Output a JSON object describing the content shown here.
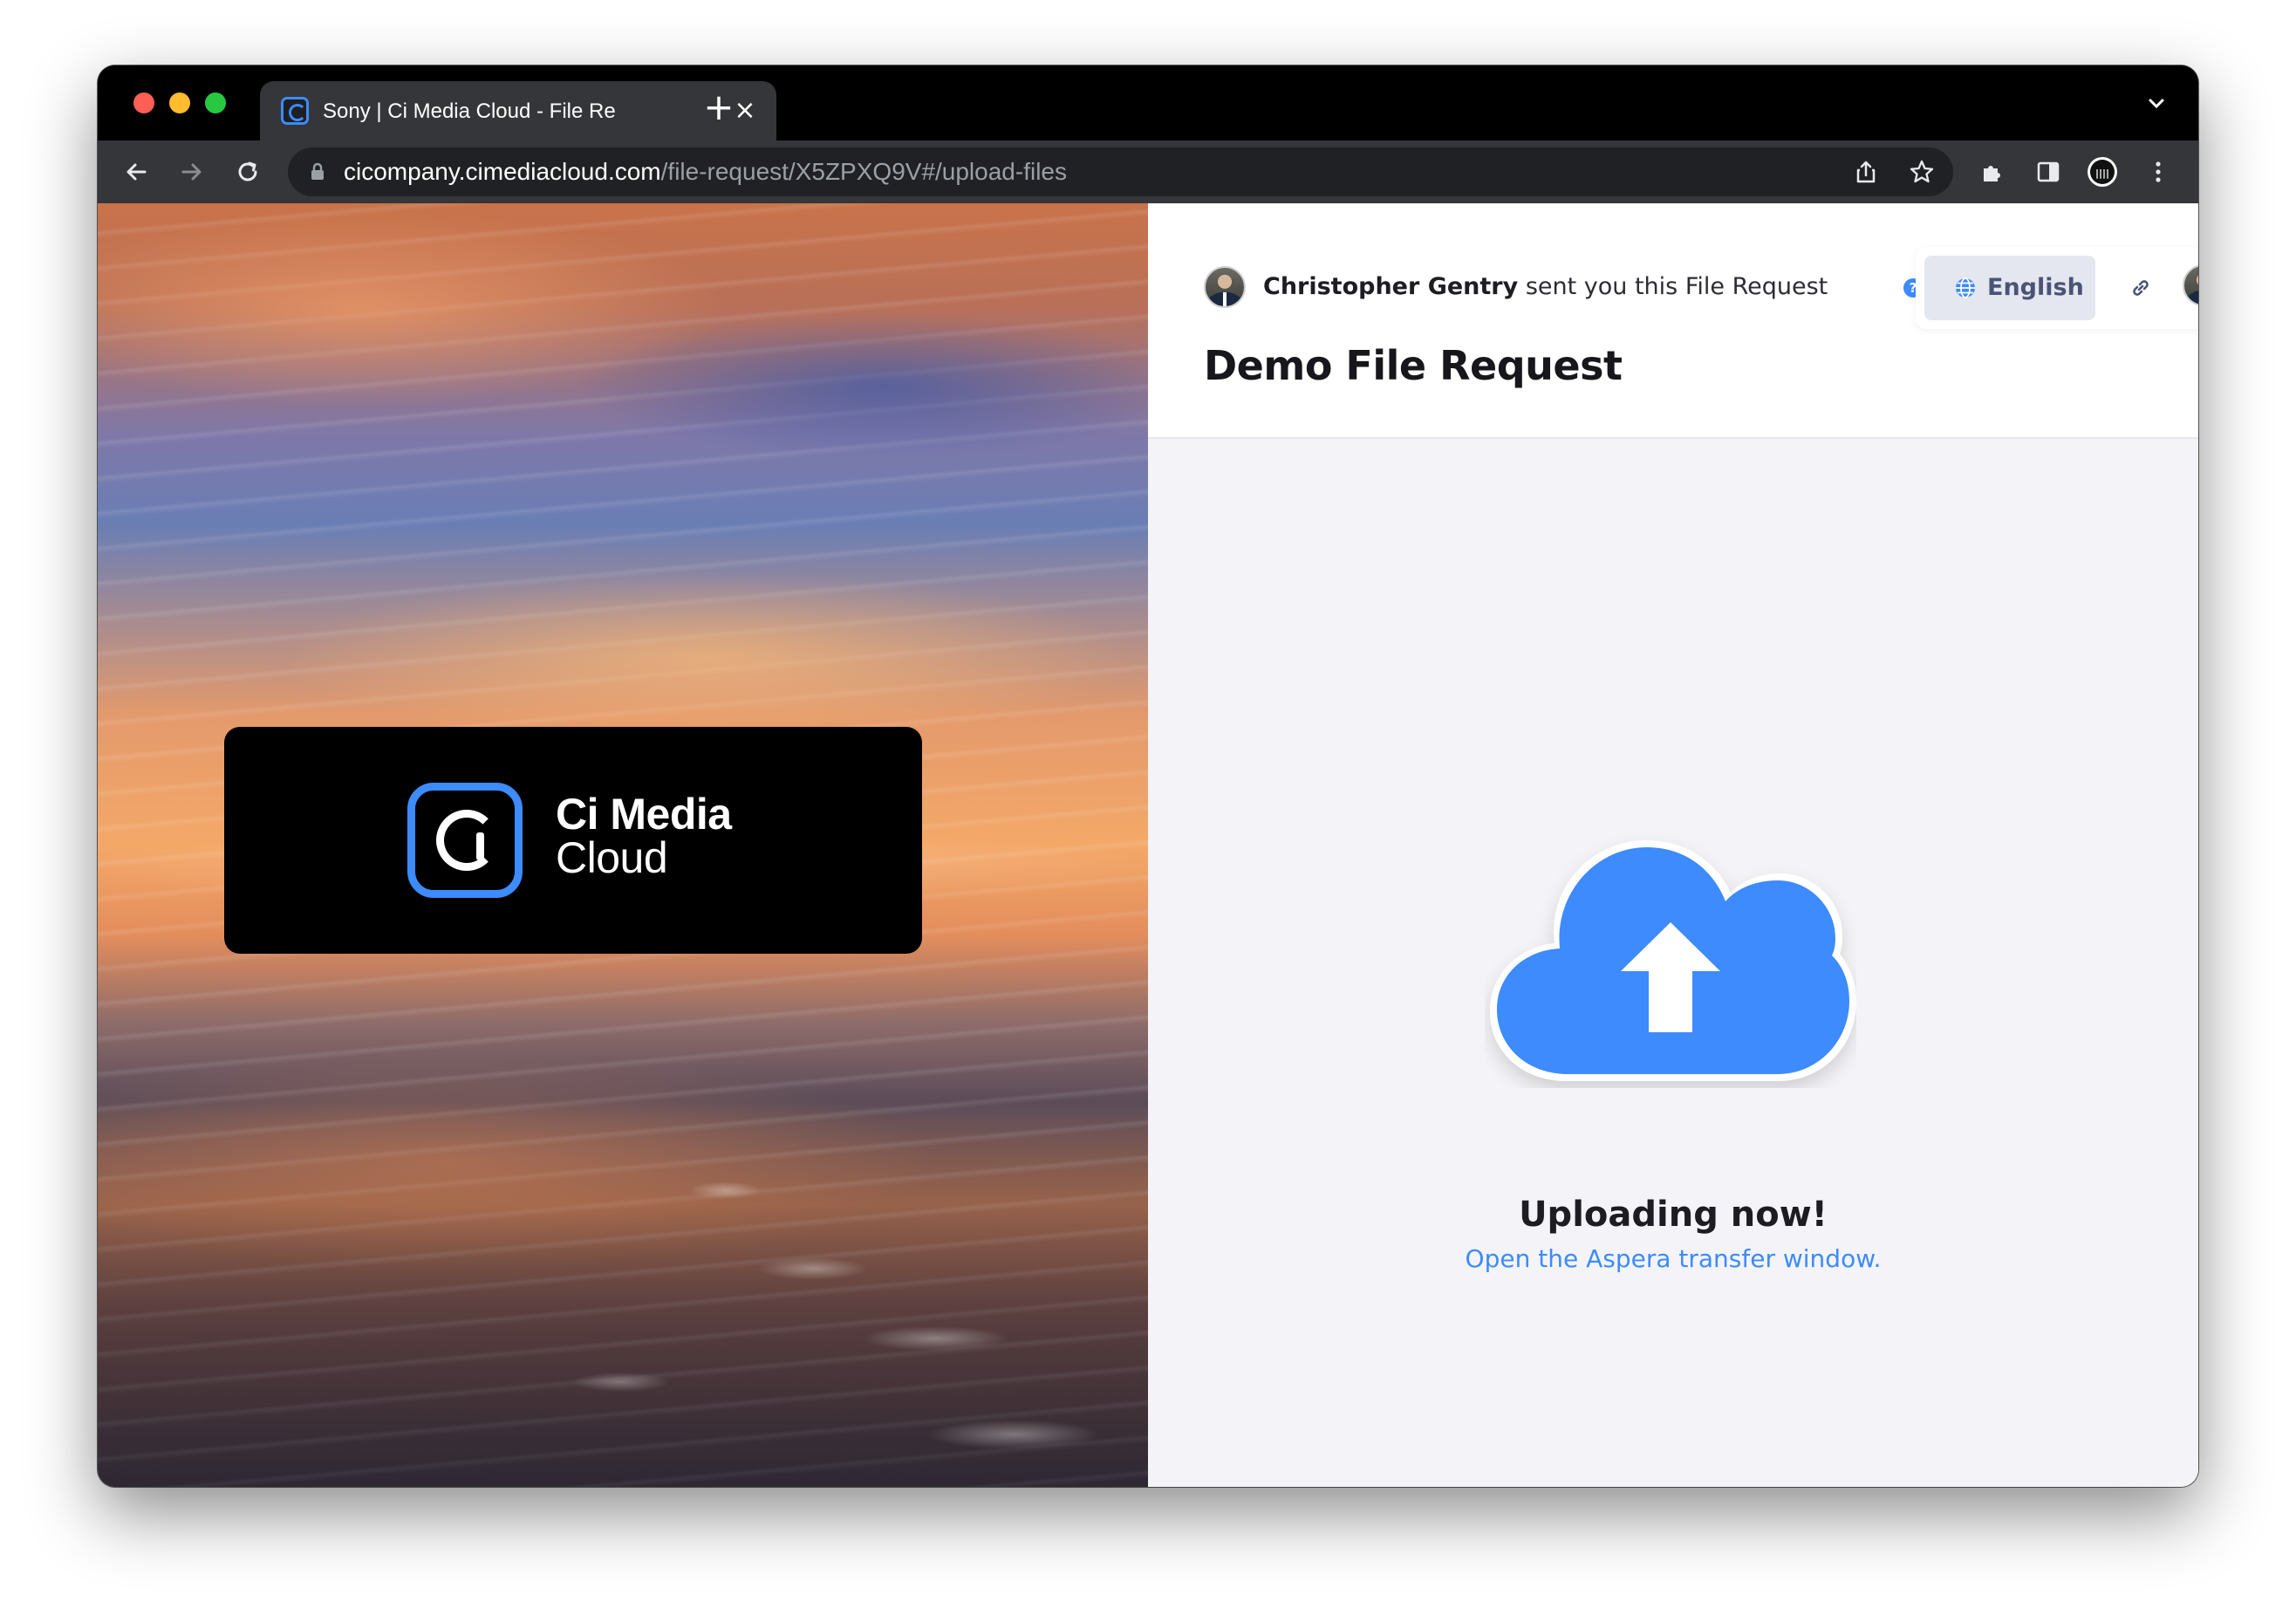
{
  "browser": {
    "tab": {
      "title": "Sony | Ci Media Cloud - File Re",
      "close_glyph": "×",
      "favicon": "ci-media-cloud-favicon"
    },
    "new_tab_glyph": "+",
    "address": {
      "host": "cicompany.cimediacloud.com",
      "path": "/file-request/X5ZPXQ9V#/upload-files"
    },
    "icons": [
      "back-icon",
      "forward-icon",
      "reload-icon",
      "lock-icon",
      "share-icon",
      "bookmark-star-icon",
      "extensions-icon",
      "side-panel-icon",
      "profile-icon",
      "more-menu-icon",
      "tab-search-chevron-icon"
    ]
  },
  "hero": {
    "logo": {
      "line1": "Ci Media",
      "line2": "Cloud"
    }
  },
  "header": {
    "sender_name": "Christopher Gentry",
    "sender_text": " sent you this File Request",
    "help_glyph": "?",
    "language": "English",
    "title": "Demo File Request"
  },
  "upload": {
    "status_title": "Uploading now!",
    "status_link": "Open the Aspera transfer window."
  },
  "colors": {
    "accent": "#3d8bfd",
    "panel_background": "#f4f4f8",
    "chrome_dark": "#35363a"
  }
}
